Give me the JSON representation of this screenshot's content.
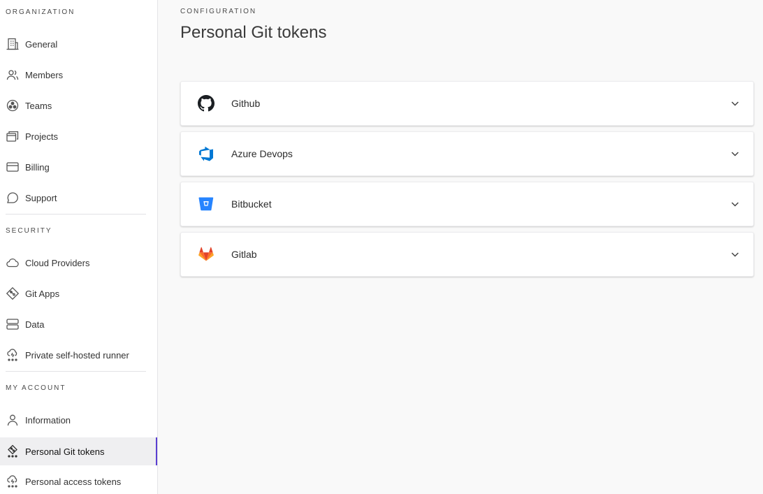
{
  "sidebar": {
    "sections": [
      {
        "label": "ORGANIZATION"
      },
      {
        "label": "SECURITY"
      },
      {
        "label": "MY ACCOUNT"
      }
    ],
    "org_items": [
      {
        "label": "General",
        "icon": "building-icon"
      },
      {
        "label": "Members",
        "icon": "users-icon"
      },
      {
        "label": "Teams",
        "icon": "team-circle-icon"
      },
      {
        "label": "Projects",
        "icon": "folders-icon"
      },
      {
        "label": "Billing",
        "icon": "credit-card-icon"
      },
      {
        "label": "Support",
        "icon": "chat-bubble-icon"
      }
    ],
    "security_items": [
      {
        "label": "Cloud Providers",
        "icon": "cloud-icon"
      },
      {
        "label": "Git Apps",
        "icon": "git-diamond-icon"
      },
      {
        "label": "Data",
        "icon": "database-icon"
      },
      {
        "label": "Private self-hosted runner",
        "icon": "runner-icon"
      }
    ],
    "account_items": [
      {
        "label": "Information",
        "icon": "user-icon"
      },
      {
        "label": "Personal Git tokens",
        "icon": "git-token-icon",
        "active": true
      },
      {
        "label": "Personal access tokens",
        "icon": "access-token-icon"
      }
    ],
    "active_accent": "#5a3fd1"
  },
  "main": {
    "breadcrumb": "CONFIGURATION",
    "title": "Personal Git tokens",
    "providers": [
      {
        "label": "Github",
        "icon": "github-icon"
      },
      {
        "label": "Azure Devops",
        "icon": "azure-devops-icon"
      },
      {
        "label": "Bitbucket",
        "icon": "bitbucket-icon"
      },
      {
        "label": "Gitlab",
        "icon": "gitlab-icon"
      }
    ]
  }
}
